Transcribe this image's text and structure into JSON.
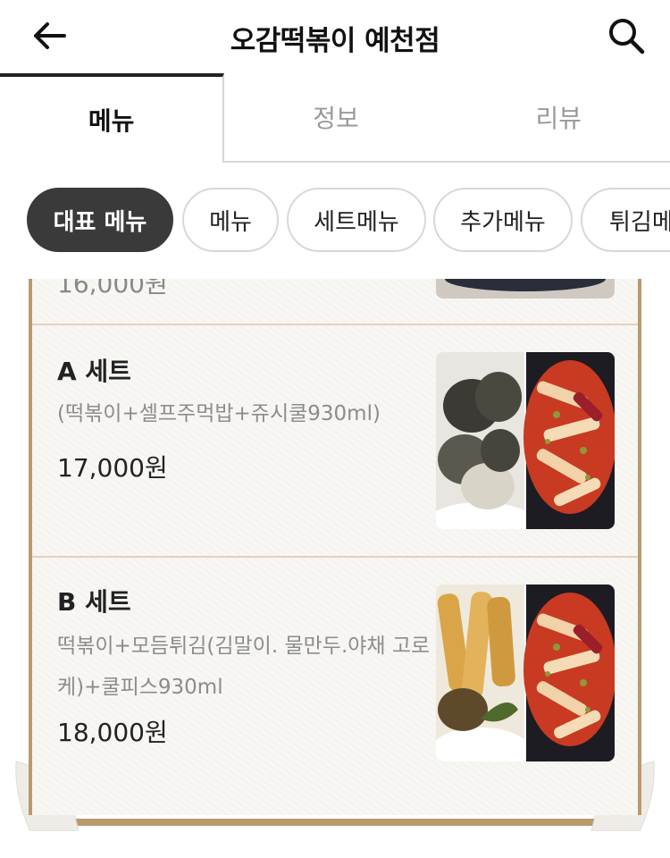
{
  "header": {
    "title": "오감떡볶이 예천점",
    "back_icon": "arrow-left-icon",
    "search_icon": "search-icon"
  },
  "tabs": [
    {
      "label": "메뉴",
      "active": true
    },
    {
      "label": "정보",
      "active": false
    },
    {
      "label": "리뷰",
      "active": false
    }
  ],
  "categories": [
    {
      "label": "대표 메뉴",
      "active": true
    },
    {
      "label": "메뉴",
      "active": false
    },
    {
      "label": "세트메뉴",
      "active": false
    },
    {
      "label": "추가메뉴",
      "active": false
    },
    {
      "label": "튀김메",
      "active": false
    }
  ],
  "menu_items": [
    {
      "name": "",
      "desc": "",
      "price": "16,000원"
    },
    {
      "name": "A 세트",
      "desc": "(떡볶이+셀프주먹밥+쥬시쿨930ml)",
      "price": "17,000원"
    },
    {
      "name": "B 세트",
      "desc": "떡볶이+모듬튀김(김말이. 물만두.야채 고로케)+쿨피스930ml",
      "price": "18,000원"
    }
  ],
  "colors": {
    "active_chip": "#3a3a3a",
    "board_border": "#b89a6e",
    "divider": "#e6cfc0"
  }
}
